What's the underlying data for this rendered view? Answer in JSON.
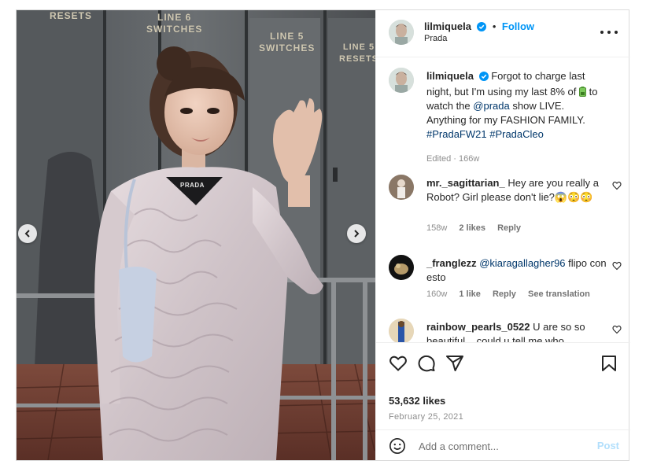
{
  "post": {
    "media": {
      "signs": [
        "RESETS",
        "LINE 6\nSWITCHES",
        "LINE 5\nSWITCHES",
        "LINE 5\nRESETS"
      ],
      "tag_text": "PRADA"
    },
    "header": {
      "username": "lilmiquela",
      "separator": "•",
      "follow_label": "Follow",
      "location": "Prada"
    },
    "caption": {
      "username": "lilmiquela",
      "text_a": "Forgot to charge last night, but I'm using my last 8% of",
      "battery_emoji": "🔋",
      "text_b": "to watch the",
      "mention": "@prada",
      "text_c": "show LIVE. Anything for my FASHION FAMILY.",
      "hashtag1": "#PradaFW21",
      "hashtag2": "#PradaCleo",
      "meta": "Edited · 166w"
    },
    "comments": [
      {
        "username": "mr._sagittarian_",
        "text": "Hey are you really a Robot? Girl please don't lie?😱😳😳",
        "time": "158w",
        "likes": "2 likes",
        "reply": "Reply"
      },
      {
        "username": "_franglezz",
        "mention": "@kiaragallagher96",
        "text": "flipo con esto",
        "time": "160w",
        "likes": "1 like",
        "reply": "Reply",
        "translate": "See translation"
      },
      {
        "username": "rainbow_pearls_0522",
        "text": "U are so so beautiful ...could u tell me who",
        "time": "",
        "likes": "",
        "reply": ""
      }
    ],
    "actions": {
      "likes": "53,632 likes",
      "date": "February 25, 2021",
      "comment_placeholder": "Add a comment...",
      "post_label": "Post"
    }
  },
  "colors": {
    "accent": "#0095f6",
    "verified": "#0095f6",
    "post_disabled": "#b2dffc",
    "muted": "#8e8e8e"
  },
  "icons": [
    "verified-badge-icon",
    "more-options-icon",
    "heart-icon",
    "comment-icon",
    "share-icon",
    "bookmark-icon",
    "emoji-icon",
    "chevron-left-icon",
    "chevron-right-icon"
  ]
}
